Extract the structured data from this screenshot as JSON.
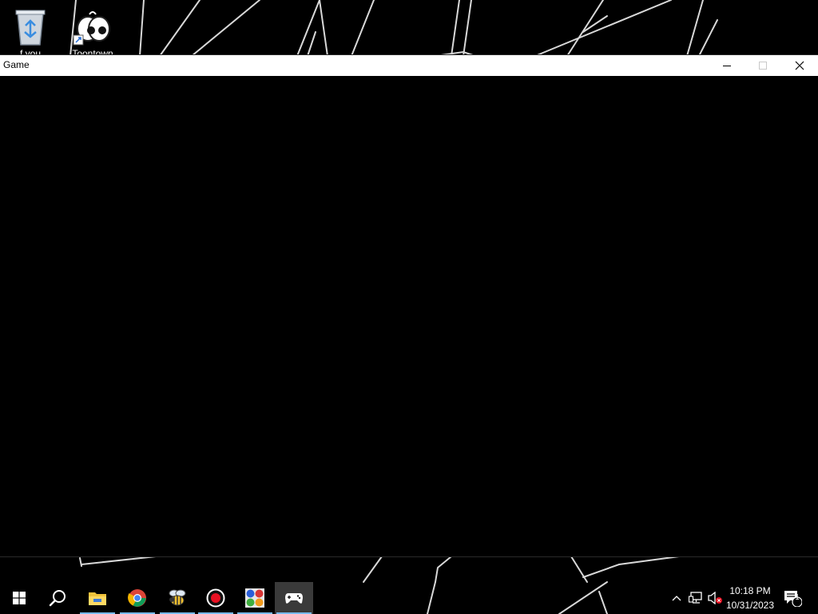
{
  "desktop": {
    "icons": [
      {
        "label": "f you",
        "icon": "recycle-bin-icon"
      },
      {
        "label": "Toontown",
        "icon": "toontown-shortcut-icon"
      }
    ]
  },
  "window": {
    "title": "Game",
    "controls": [
      "minimize-icon",
      "maximize-icon",
      "close-icon"
    ]
  },
  "taskbar": {
    "buttons": [
      {
        "name": "start",
        "icon": "windows-logo-icon",
        "running": false
      },
      {
        "name": "search",
        "icon": "search-icon",
        "running": false
      },
      {
        "name": "file-explorer",
        "icon": "folder-icon",
        "running": true
      },
      {
        "name": "chrome",
        "icon": "chrome-icon",
        "running": true
      },
      {
        "name": "bee-app",
        "icon": "bee-icon",
        "running": true
      },
      {
        "name": "recorder",
        "icon": "record-icon",
        "running": true
      },
      {
        "name": "color-app",
        "icon": "color-grid-icon",
        "running": true
      },
      {
        "name": "game",
        "icon": "gamepad-icon",
        "running": true,
        "active": true
      }
    ],
    "tray": {
      "icons": [
        "chevron-up-icon",
        "network-icon",
        "volume-muted-icon"
      ],
      "time": "10:18 PM",
      "date": "10/31/2023",
      "notification_count": "1"
    },
    "accent_color": "#76b9ed"
  }
}
